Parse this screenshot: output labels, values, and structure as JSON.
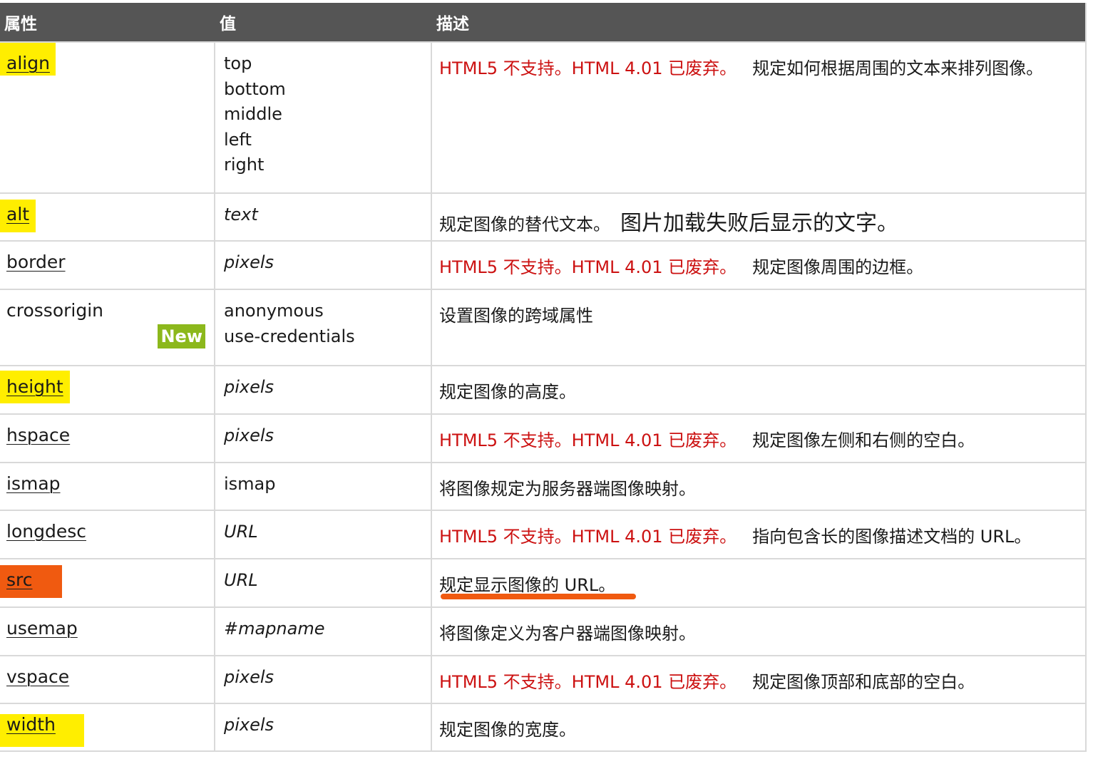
{
  "header": {
    "col_attr": "属性",
    "col_value": "值",
    "col_desc": "描述"
  },
  "rows": [
    {
      "attr": "align",
      "values": [
        "top",
        "bottom",
        "middle",
        "left",
        "right"
      ],
      "deprecated": "HTML5 不支持。HTML 4.01 已废弃。",
      "desc": "规定如何根据周围的文本来排列图像。"
    },
    {
      "attr": "alt",
      "values": [
        "text"
      ],
      "desc": "规定图像的替代文本。",
      "note": "图片加载失败后显示的文字。"
    },
    {
      "attr": "border",
      "values": [
        "pixels"
      ],
      "deprecated": "HTML5 不支持。HTML 4.01 已废弃。",
      "desc": "规定图像周围的边框。"
    },
    {
      "attr": "crossorigin",
      "badge": "New",
      "values": [
        "anonymous",
        "use-credentials"
      ],
      "desc": "设置图像的跨域属性"
    },
    {
      "attr": "height",
      "values": [
        "pixels"
      ],
      "desc": "规定图像的高度。"
    },
    {
      "attr": "hspace",
      "values": [
        "pixels"
      ],
      "deprecated": "HTML5 不支持。HTML 4.01 已废弃。",
      "desc": "规定图像左侧和右侧的空白。"
    },
    {
      "attr": "ismap",
      "values": [
        "ismap"
      ],
      "desc": "将图像规定为服务器端图像映射。"
    },
    {
      "attr": "longdesc",
      "values": [
        "URL"
      ],
      "deprecated": "HTML5 不支持。HTML 4.01 已废弃。",
      "desc": "指向包含长的图像描述文档的 URL。"
    },
    {
      "attr": "src",
      "values": [
        "URL"
      ],
      "desc": "规定显示图像的 URL。"
    },
    {
      "attr": "usemap",
      "values": [
        "#mapname"
      ],
      "desc": "将图像定义为客户器端图像映射。"
    },
    {
      "attr": "vspace",
      "values": [
        "pixels"
      ],
      "deprecated": "HTML5 不支持。HTML 4.01 已废弃。",
      "desc": "规定图像顶部和底部的空白。"
    },
    {
      "attr": "width",
      "values": [
        "pixels"
      ],
      "desc": "规定图像的宽度。"
    }
  ],
  "colors": {
    "header_bg": "#555555",
    "highlight_yellow": "#ffee00",
    "highlight_orange": "#f05a10",
    "deprecated_red": "#cc1111",
    "new_badge": "#8cb81c"
  }
}
